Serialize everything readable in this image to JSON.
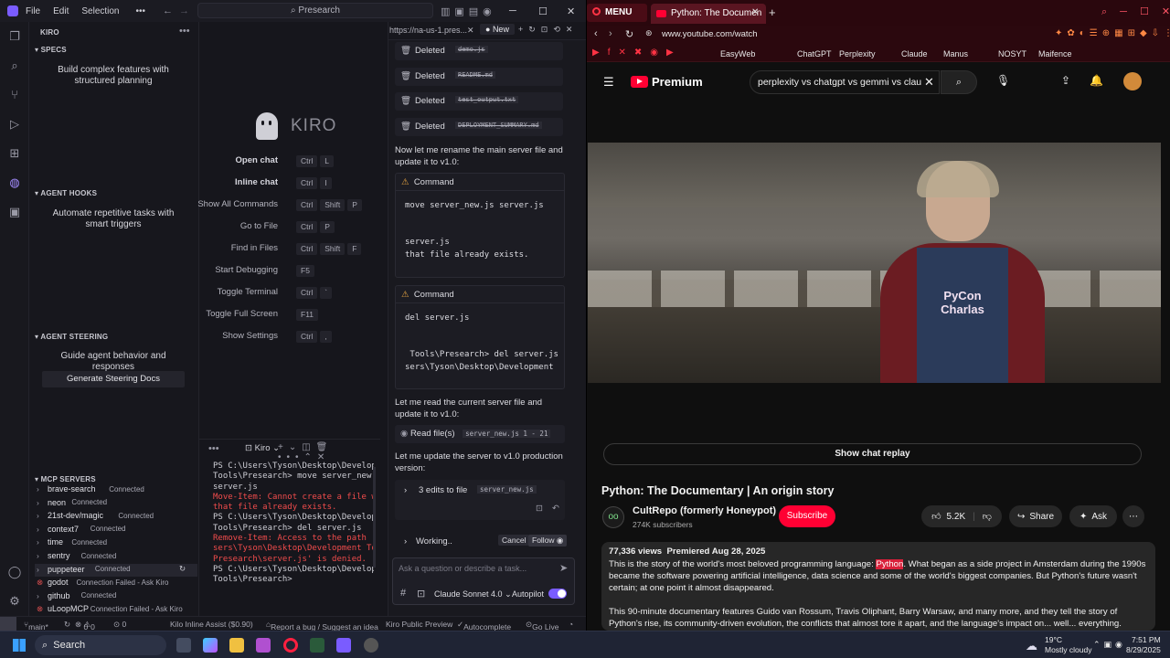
{
  "kiro": {
    "menu": [
      "File",
      "Edit",
      "Selection"
    ],
    "search_placeholder": "Presearch",
    "panel_title": "KIRO",
    "specs": {
      "heading": "SPECS",
      "text": "Build complex features with structured planning"
    },
    "hooks": {
      "heading": "AGENT HOOKS",
      "text": "Automate repetitive tasks with smart triggers"
    },
    "steering": {
      "heading": "AGENT STEERING",
      "text": "Guide agent behavior and responses",
      "button": "Generate Steering Docs"
    },
    "mcp": {
      "heading": "MCP SERVERS",
      "servers": [
        {
          "name": "brave-search",
          "status": "Connected",
          "ok": true
        },
        {
          "name": "neon",
          "status": "Connected",
          "ok": true
        },
        {
          "name": "21st-dev/magic",
          "status": "Connected",
          "ok": true
        },
        {
          "name": "context7",
          "status": "Connected",
          "ok": true
        },
        {
          "name": "time",
          "status": "Connected",
          "ok": true
        },
        {
          "name": "sentry",
          "status": "Connected",
          "ok": true
        },
        {
          "name": "puppeteer",
          "status": "Connected",
          "ok": true
        },
        {
          "name": "godot",
          "status": "Connection Failed - Ask Kiro",
          "ok": false
        },
        {
          "name": "github",
          "status": "Connected",
          "ok": true
        },
        {
          "name": "uLoopMCP",
          "status": "Connection Failed - Ask Kiro",
          "ok": false
        }
      ]
    },
    "welcome": {
      "logo": "KIRO",
      "shortcuts": [
        {
          "label": "Open chat",
          "keys": [
            "Ctrl",
            "L"
          ],
          "bold": true
        },
        {
          "label": "Inline chat",
          "keys": [
            "Ctrl",
            "I"
          ],
          "bold": true
        },
        {
          "label": "Show All Commands",
          "keys": [
            "Ctrl",
            "Shift",
            "P"
          ],
          "bold": false
        },
        {
          "label": "Go to File",
          "keys": [
            "Ctrl",
            "P"
          ],
          "bold": false
        },
        {
          "label": "Find in Files",
          "keys": [
            "Ctrl",
            "Shift",
            "F"
          ],
          "bold": false
        },
        {
          "label": "Start Debugging",
          "keys": [
            "F5"
          ],
          "bold": false
        },
        {
          "label": "Toggle Terminal",
          "keys": [
            "Ctrl",
            "`"
          ],
          "bold": false
        },
        {
          "label": "Toggle Full Screen",
          "keys": [
            "F11"
          ],
          "bold": false
        },
        {
          "label": "Show Settings",
          "keys": [
            "Ctrl",
            ","
          ],
          "bold": false
        }
      ]
    },
    "terminal": {
      "tab": "Kiro",
      "lines": [
        {
          "text": "PS C:\\Users\\Tyson\\Desktop\\Development",
          "color": "#cfcfd6"
        },
        {
          "text": "Tools\\Presearch> move server_new.js",
          "color": "#cfcfd6"
        },
        {
          "text": "server.js",
          "color": "#cfcfd6"
        },
        {
          "text": "Move-Item: Cannot create a file when",
          "color": "#f14c4c"
        },
        {
          "text": "that file already exists.",
          "color": "#f14c4c"
        },
        {
          "text": "PS C:\\Users\\Tyson\\Desktop\\Development",
          "color": "#cfcfd6"
        },
        {
          "text": "Tools\\Presearch> del server.js",
          "color": "#cfcfd6"
        },
        {
          "text": "Remove-Item: Access to the path 'C:\\U",
          "color": "#f14c4c"
        },
        {
          "text": "sers\\Tyson\\Desktop\\Development Tools\\",
          "color": "#f14c4c"
        },
        {
          "text": "Presearch\\server.js' is denied.",
          "color": "#f14c4c"
        },
        {
          "text": "PS C:\\Users\\Tyson\\Desktop\\Development",
          "color": "#cfcfd6"
        },
        {
          "text": "Tools\\Presearch>",
          "color": "#cfcfd6"
        }
      ]
    },
    "chat": {
      "tab_url": "https://na-us-1.pres...",
      "new_label": "New",
      "deleted_label": "Deleted",
      "deleted_files": [
        "demo.js",
        "README.md",
        "test_output.txt",
        "DEPLOYMENT_SUMMARY.md"
      ],
      "msg1": "Now let me rename the main server file and update it to v1.0:",
      "cmd1": {
        "title": "Command",
        "command": "move server_new.js server.js",
        "out1": "server.js",
        "out2": "that file already exists."
      },
      "cmd2": {
        "title": "Command",
        "command": "del server.js",
        "out1": " Tools\\Presearch> del server.js",
        "out2": "sers\\Tyson\\Desktop\\Development"
      },
      "msg2": "Let me read the current server file and update it to v1.0:",
      "read_label": "Read file(s)",
      "read_file": "server_new.js 1 - 21",
      "msg3": "Let me update the server to v1.0 production version:",
      "edits_label": "3 edits to file",
      "edits_file": "server_new.js",
      "working": "Working..",
      "cancel": "Cancel",
      "follow": "Follow",
      "input_placeholder": "Ask a question or describe a task...",
      "model": "Claude Sonnet 4.0",
      "autopilot": "Autopilot"
    },
    "status": {
      "branch": "main*",
      "errors": "0",
      "warnings": "0",
      "inline": "Kilo Inline Assist ($0.90)",
      "report": "Report a bug / Suggest an idea",
      "preview": "Kiro Public Preview",
      "autocomplete": "Autocomplete",
      "golive": "Go Live"
    }
  },
  "browser": {
    "menu_label": "MENU",
    "tab_title": "Python: The Documen",
    "url": "www.youtube.com/watch",
    "bookmarks": [
      "EasyWeb",
      "ChatGPT",
      "Perplexity",
      "Claude",
      "Manus",
      "NOSYT",
      "Maifence"
    ],
    "colors": {
      "youtube_red": "#ff0033",
      "tab_bg": "#2a070d"
    },
    "youtube": {
      "logo": "Premium",
      "search_value": "perplexity vs chatgpt vs gemmi vs clau",
      "show_chat_replay": "Show chat replay",
      "video_title": "Python: The Documentary | An origin story",
      "channel": "CultRepo (formerly Honeypot)",
      "subscribers": "274K subscribers",
      "subscribe": "Subscribe",
      "likes": "5.2K",
      "share": "Share",
      "ask": "Ask",
      "shirt_text": "PyCon Charlas",
      "stats": "77,336 views  Premiered Aug 28, 2025",
      "desc_pre": "This is the story of the world's most beloved programming language: ",
      "desc_highlight": "Python",
      "desc_post": ". What began as a side project in Amsterdam during the 1990s became the software powering artificial intelligence, data science and some of the world's biggest companies. But Python's future wasn't certain; at one point it almost disappeared.",
      "desc2": "This 90-minute documentary features Guido van Rossum, Travis Oliphant, Barry Warsaw, and many more, and they tell the story of Python's rise, its community-driven evolution, the conflicts that almost tore it apart, and the language's impact on... well... everything."
    }
  },
  "taskbar": {
    "search": "Search",
    "weather_temp": "19°C",
    "weather_desc": "Mostly cloudy",
    "time": "7:51 PM",
    "date": "8/29/2025"
  }
}
